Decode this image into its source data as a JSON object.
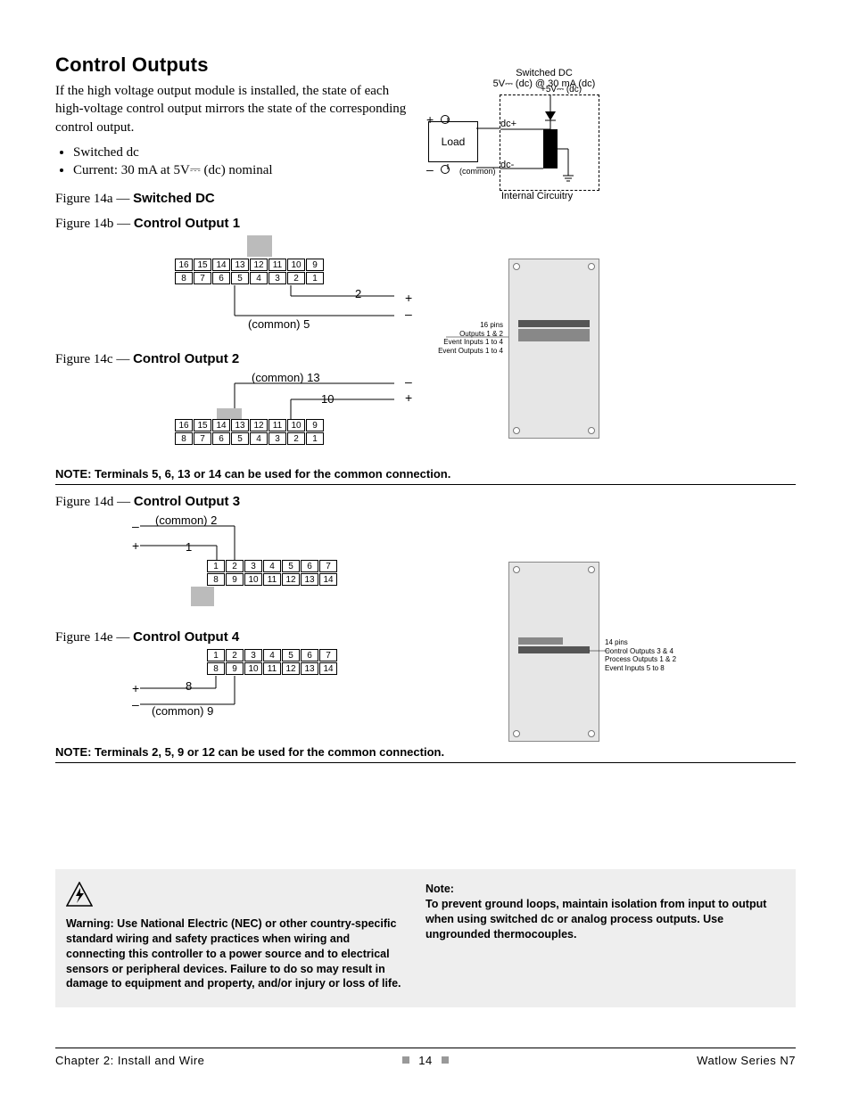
{
  "heading": "Control Outputs",
  "intro": "If the high voltage output module is installed, the state of each high-voltage control output mirrors the state of the corresponding control output.",
  "bullets": [
    "Switched dc",
    "Current: 30 mA at 5V⎓ (dc) nominal"
  ],
  "fig14a_pre": "Figure 14a — ",
  "fig14a_bold": "Switched DC",
  "fig14b_pre": "Figure 14b — ",
  "fig14b_bold": "Control Output 1",
  "fig14c_pre": "Figure 14c — ",
  "fig14c_bold": "Control Output 2",
  "fig14d_pre": "Figure 14d — ",
  "fig14d_bold": "Control Output 3",
  "fig14e_pre": "Figure 14e — ",
  "fig14e_bold": "Control Output 4",
  "note1": "NOTE: Terminals 5, 6, 13 or 14 can be used for the common connection.",
  "note2": "NOTE: Terminals 2, 5, 9 or 12 can be used for the common connection.",
  "circuit": {
    "title1": "Switched DC",
    "title2": "5V⎓ (dc) @ 30 mA (dc)",
    "v5": "+5V⎓ (dc)",
    "dcp": "dc+",
    "dcm": "dc-",
    "load": "Load",
    "common": "(common)",
    "internal": "Internal Circuitry",
    "plus": "+",
    "minus": "–"
  },
  "terminals16_top": [
    "16",
    "15",
    "14",
    "13",
    "12",
    "11",
    "10",
    "9"
  ],
  "terminals16_bot": [
    "8",
    "7",
    "6",
    "5",
    "4",
    "3",
    "2",
    "1"
  ],
  "terminals14_top": [
    "1",
    "2",
    "3",
    "4",
    "5",
    "6",
    "7"
  ],
  "terminals14_bot": [
    "8",
    "9",
    "10",
    "11",
    "12",
    "13",
    "14"
  ],
  "b": {
    "pin2": "2",
    "common5": "(common) 5",
    "plus": "+",
    "minus": "–"
  },
  "c": {
    "common13": "(common) 13",
    "pin10": "10",
    "plus": "+",
    "minus": "–"
  },
  "d": {
    "common2": "(common) 2",
    "pin1": "1",
    "plus": "+",
    "minus": "–"
  },
  "e": {
    "pin8": "8",
    "common9": "(common) 9",
    "plus": "+",
    "minus": "–"
  },
  "board1_labels": {
    "l1": "16 pins",
    "l2": "Outputs 1 & 2",
    "l3": "Event Inputs 1 to 4",
    "l4": "Event Outputs 1 to 4"
  },
  "board2_labels": {
    "l1": "14 pins",
    "l2": "Control Outputs 3 & 4",
    "l3": "Process Outputs 1 & 2",
    "l4": "Event Inputs 5 to 8"
  },
  "warn_label": "Warning: Use National Electric (NEC) or other country-specific standard wiring and safety practices when wiring and connecting this controller to a power source and to electrical sensors or peripheral devices. Failure to do so may result in damage to equipment and property, and/or injury or loss of life.",
  "note_label_head": "Note:",
  "note_label_body": "To prevent ground loops, maintain isolation from input to output when using switched dc or analog process outputs. Use ungrounded thermocouples.",
  "footer": {
    "left": "Chapter 2: Install and Wire",
    "page": "14",
    "right": "Watlow Series N7"
  }
}
